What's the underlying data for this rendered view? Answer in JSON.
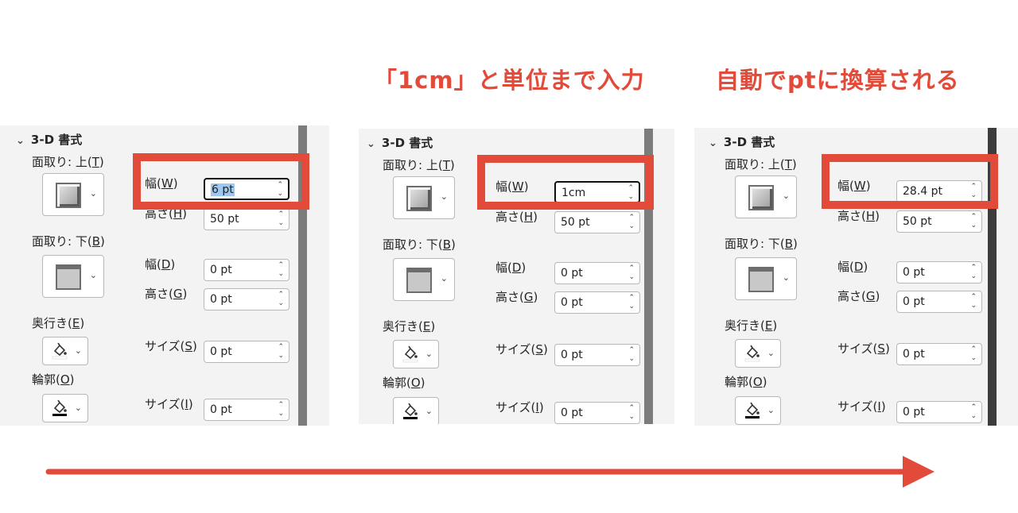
{
  "captions": {
    "middle": "「1cm」と単位まで入力",
    "right": "自動でptに換算される"
  },
  "labels": {
    "section_title": "3-D 書式",
    "bevel_top": [
      "面取り: 上(",
      "T",
      ")"
    ],
    "bevel_bottom": [
      "面取り: 下(",
      "B",
      ")"
    ],
    "depth": [
      "奥行き(",
      "E",
      ")"
    ],
    "contour": [
      "輪郭(",
      "O",
      ")"
    ],
    "width_w": [
      "幅(",
      "W",
      ")"
    ],
    "height_h": [
      "高さ(",
      "H",
      ")"
    ],
    "width_d": [
      "幅(",
      "D",
      ")"
    ],
    "height_g": [
      "高さ(",
      "G",
      ")"
    ],
    "size_s": [
      "サイズ(",
      "S",
      ")"
    ],
    "size_i": [
      "サイズ(",
      "I",
      ")"
    ]
  },
  "panels": [
    {
      "top_width": "6 pt",
      "top_height": "50 pt",
      "bottom_width": "0 pt",
      "bottom_height": "0 pt",
      "depth_size": "0 pt",
      "contour_size": "0 pt"
    },
    {
      "top_width": "1cm",
      "top_height": "50 pt",
      "bottom_width": "0 pt",
      "bottom_height": "0 pt",
      "depth_size": "0 pt",
      "contour_size": "0 pt"
    },
    {
      "top_width": "28.4 pt",
      "top_height": "50 pt",
      "bottom_width": "0 pt",
      "bottom_height": "0 pt",
      "depth_size": "0 pt",
      "contour_size": "0 pt"
    }
  ],
  "colors": {
    "accent_red": "#e24b3a",
    "panel_bg": "#f3f3f3",
    "scrollbar_light": "#7c7c7c",
    "scrollbar_dark": "#3c3c3c"
  },
  "icons": {
    "arrow": "right-arrow-icon",
    "chevron": "chevron-down-icon",
    "fill": "paint-bucket-icon"
  }
}
